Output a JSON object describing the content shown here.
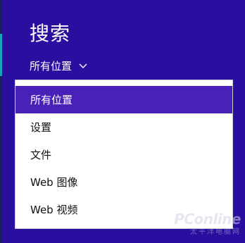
{
  "search": {
    "title": "搜索",
    "scope_selected": "所有位置"
  },
  "dropdown": {
    "items": [
      {
        "label": "所有位置",
        "selected": true
      },
      {
        "label": "设置",
        "selected": false
      },
      {
        "label": "文件",
        "selected": false
      },
      {
        "label": "Web 图像",
        "selected": false
      },
      {
        "label": "Web 视频",
        "selected": false
      }
    ]
  },
  "watermark": {
    "logo": "PConline",
    "sub": "太平洋电脑网"
  },
  "colors": {
    "background": "#2a0ea0",
    "selected_item": "#4a21b8",
    "menu_background": "#ffffff"
  }
}
